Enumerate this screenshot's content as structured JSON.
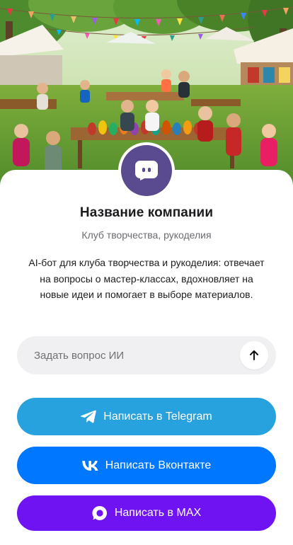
{
  "hero": {
    "image_description": ""
  },
  "company": {
    "name": "Название компании",
    "category": "Клуб творчества, рукоделия",
    "description": "AI-бот для клуба творчества и рукоделия: отвечает на вопросы о мастер-классах, вдохновляет на новые идеи и помогает в выборе материалов.",
    "avatar_icon": "chat-bot-icon",
    "avatar_color": "#5a4a8f"
  },
  "ask": {
    "placeholder": "Задать вопрос ИИ",
    "value": "",
    "send_icon": "arrow-up-icon"
  },
  "buttons": {
    "telegram": {
      "label": "Написать в Telegram",
      "icon": "telegram-icon",
      "color": "#27a2df"
    },
    "vk": {
      "label": "Написать Вконтакте",
      "icon": "vk-icon",
      "color": "#0077ff"
    },
    "max": {
      "label": "Написать в MAX",
      "icon": "max-icon",
      "color": "#6f13f3"
    }
  }
}
